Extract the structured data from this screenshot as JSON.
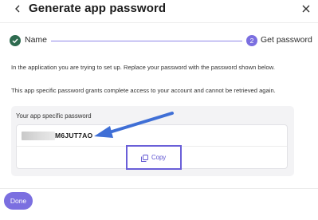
{
  "header": {
    "title": "Generate app password",
    "back_icon": "chevron-left-icon",
    "close_icon": "close-icon"
  },
  "stepper": {
    "steps": [
      {
        "label": "Name",
        "status": "completed",
        "icon": "check-circle-icon"
      },
      {
        "label": "Get password",
        "status": "current",
        "number": "2"
      }
    ],
    "accent_color": "#7b6fe0",
    "completed_color": "#2e6b4f"
  },
  "description": {
    "line1": "In the application you are trying to set up. Replace your password with the password shown below.",
    "line2": "This app specific password grants complete access to your account and cannot be retrieved again."
  },
  "password_card": {
    "label": "Your app specific password",
    "visible_value": "M6JUT7AO",
    "copy_label": "Copy",
    "copy_icon": "copy-icon",
    "annotation_arrow_icon": "arrow-icon",
    "annotation_color": "#3f6fd6"
  },
  "footer": {
    "done_label": "Done"
  }
}
